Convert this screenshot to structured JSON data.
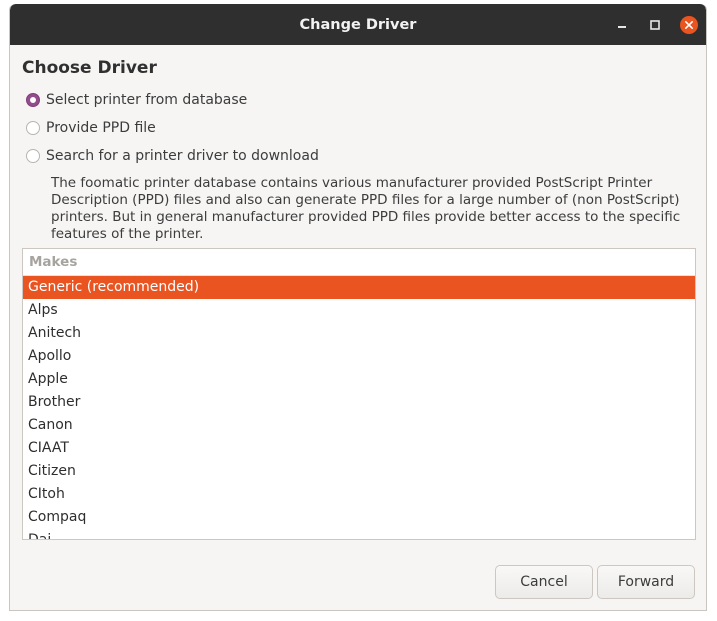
{
  "window": {
    "title": "Change Driver"
  },
  "heading": "Choose Driver",
  "options": [
    {
      "label": "Select printer from database",
      "checked": true
    },
    {
      "label": "Provide PPD file",
      "checked": false
    },
    {
      "label": "Search for a printer driver to download",
      "checked": false
    }
  ],
  "description": "The foomatic printer database contains various manufacturer provided PostScript Printer Description (PPD) files and also can generate PPD files for a large number of (non PostScript) printers. But in general manufacturer provided PPD files provide better access to the specific features of the printer.",
  "makes": {
    "header": "Makes",
    "items": [
      "Generic (recommended)",
      "Alps",
      "Anitech",
      "Apollo",
      "Apple",
      "Brother",
      "Canon",
      "CIAAT",
      "Citizen",
      "CItoh",
      "Compaq",
      "Dai"
    ],
    "selected_index": 0
  },
  "buttons": {
    "cancel": "Cancel",
    "forward": "Forward"
  },
  "colors": {
    "accent": "#e95420",
    "radio_checked": "#924d8b",
    "titlebar": "#2f2f2f"
  }
}
